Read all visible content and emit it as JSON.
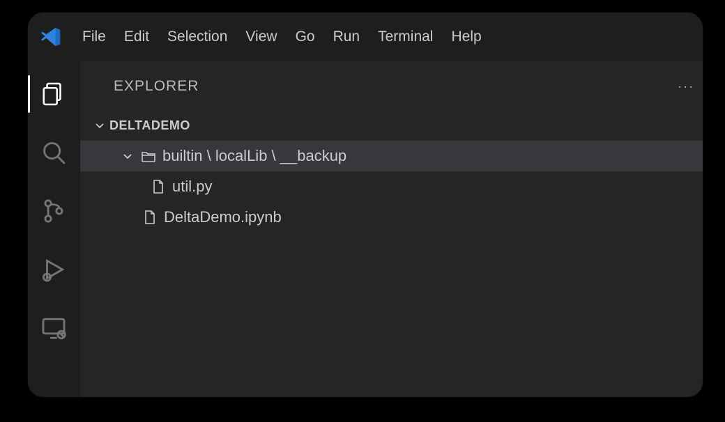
{
  "menu": {
    "file": "File",
    "edit": "Edit",
    "selection": "Selection",
    "view": "View",
    "go": "Go",
    "run": "Run",
    "terminal": "Terminal",
    "help": "Help"
  },
  "explorer": {
    "title": "EXPLORER",
    "more": "···",
    "workspace": "DELTADEMO"
  },
  "tree": {
    "folder_path": "builtin \\ localLib \\ __backup",
    "file_util": "util.py",
    "file_notebook": "DeltaDemo.ipynb"
  }
}
